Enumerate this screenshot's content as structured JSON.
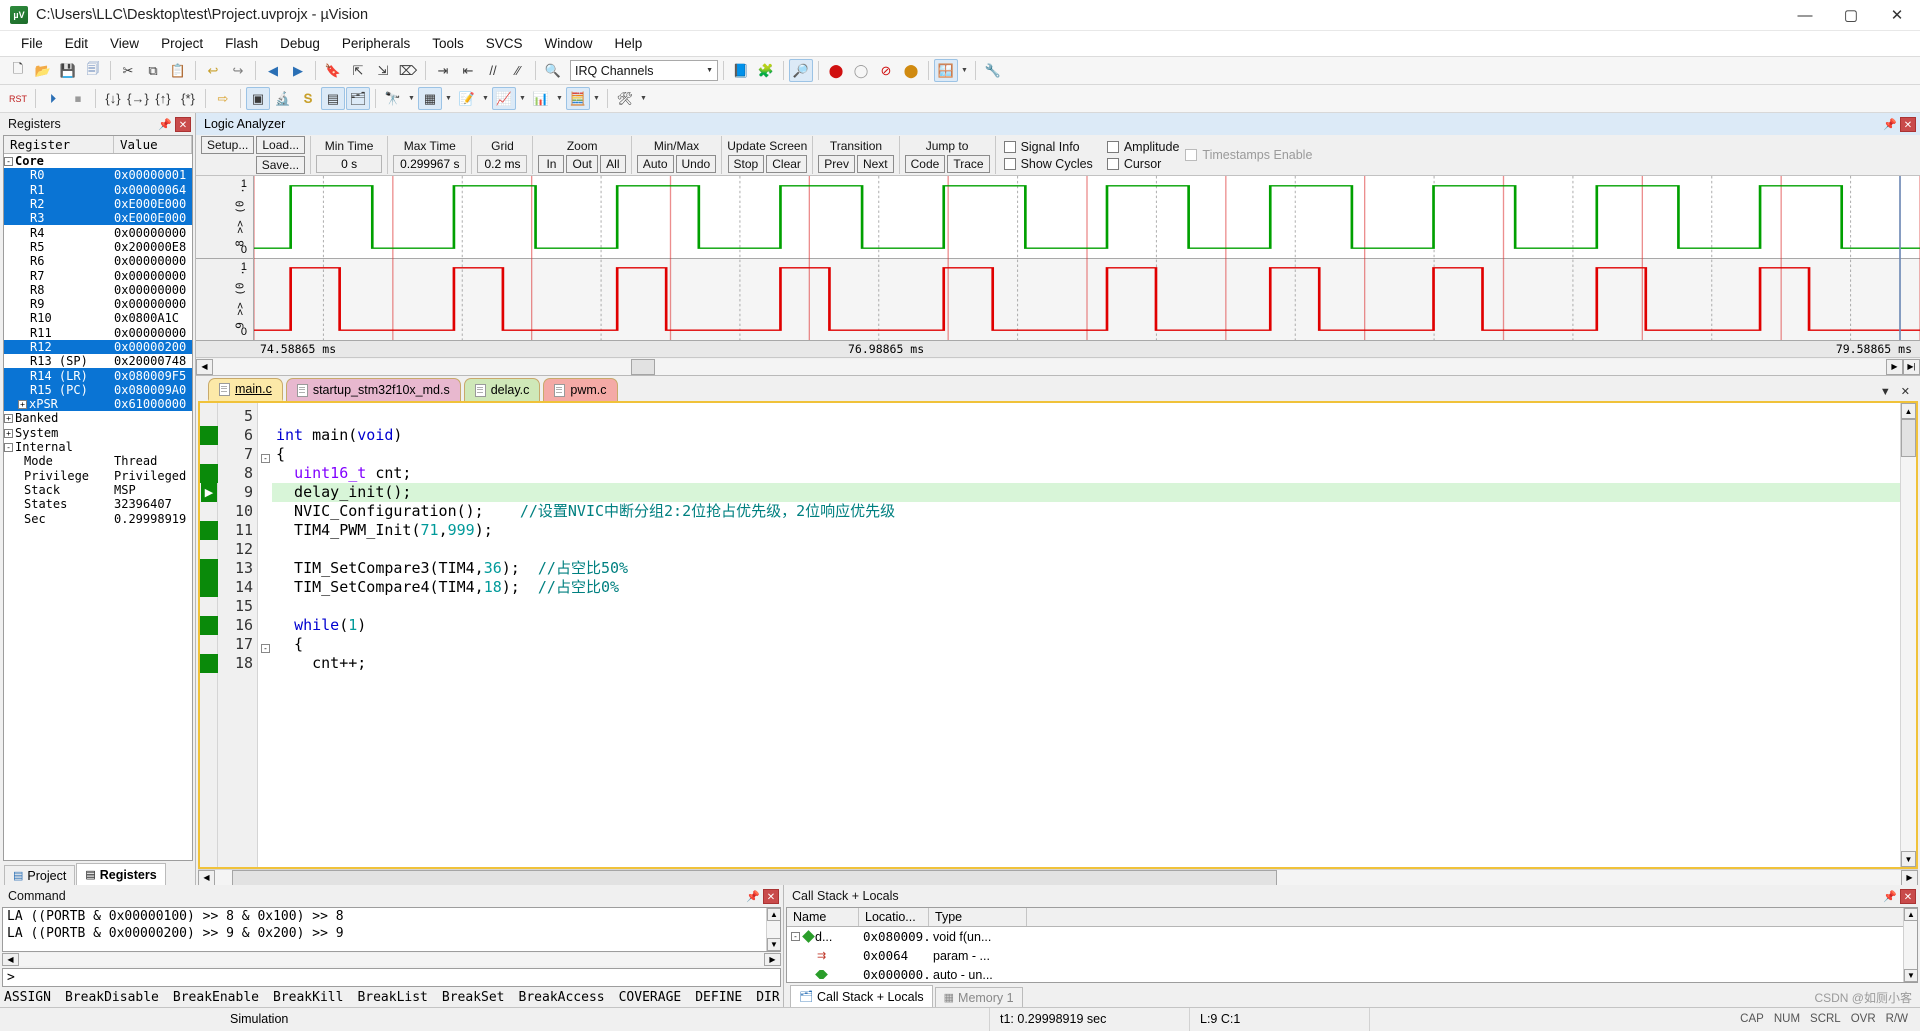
{
  "window": {
    "title": "C:\\Users\\LLC\\Desktop\\test\\Project.uvprojx - µVision",
    "icon": "uvision-logo",
    "minimize": "—",
    "maximize": "▢",
    "close": "✕"
  },
  "menu": [
    "File",
    "Edit",
    "View",
    "Project",
    "Flash",
    "Debug",
    "Peripherals",
    "Tools",
    "SVCS",
    "Window",
    "Help"
  ],
  "toolbar2": {
    "combo_value": "IRQ Channels"
  },
  "registers_pane": {
    "title": "Registers",
    "columns": [
      "Register",
      "Value"
    ],
    "rows": [
      {
        "name": "Core",
        "value": "",
        "level": 0,
        "group": true,
        "toggle": "-",
        "selected": false
      },
      {
        "name": "R0",
        "value": "0x00000001",
        "level": 2,
        "selected": true
      },
      {
        "name": "R1",
        "value": "0x00000064",
        "level": 2,
        "selected": true
      },
      {
        "name": "R2",
        "value": "0xE000E000",
        "level": 2,
        "selected": true
      },
      {
        "name": "R3",
        "value": "0xE000E000",
        "level": 2,
        "selected": true
      },
      {
        "name": "R4",
        "value": "0x00000000",
        "level": 2,
        "selected": false
      },
      {
        "name": "R5",
        "value": "0x200000E8",
        "level": 2,
        "selected": false
      },
      {
        "name": "R6",
        "value": "0x00000000",
        "level": 2,
        "selected": false
      },
      {
        "name": "R7",
        "value": "0x00000000",
        "level": 2,
        "selected": false
      },
      {
        "name": "R8",
        "value": "0x00000000",
        "level": 2,
        "selected": false
      },
      {
        "name": "R9",
        "value": "0x00000000",
        "level": 2,
        "selected": false
      },
      {
        "name": "R10",
        "value": "0x0800A1C",
        "level": 2,
        "selected": false
      },
      {
        "name": "R11",
        "value": "0x00000000",
        "level": 2,
        "selected": false
      },
      {
        "name": "R12",
        "value": "0x00000200",
        "level": 2,
        "selected": true
      },
      {
        "name": "R13 (SP)",
        "value": "0x20000748",
        "level": 2,
        "selected": false
      },
      {
        "name": "R14 (LR)",
        "value": "0x080009F5",
        "level": 2,
        "selected": true
      },
      {
        "name": "R15 (PC)",
        "value": "0x080009A0",
        "level": 2,
        "selected": true
      },
      {
        "name": "xPSR",
        "value": "0x61000000",
        "level": 2,
        "toggle": "+",
        "selected": true
      },
      {
        "name": "Banked",
        "value": "",
        "level": 0,
        "group": false,
        "toggle": "+",
        "selected": false
      },
      {
        "name": "System",
        "value": "",
        "level": 0,
        "group": false,
        "toggle": "+",
        "selected": false
      },
      {
        "name": "Internal",
        "value": "",
        "level": 0,
        "group": false,
        "toggle": "-",
        "selected": false
      },
      {
        "name": "Mode",
        "value": "Thread",
        "level": 1,
        "selected": false
      },
      {
        "name": "Privilege",
        "value": "Privileged",
        "level": 1,
        "selected": false
      },
      {
        "name": "Stack",
        "value": "MSP",
        "level": 1,
        "selected": false
      },
      {
        "name": "States",
        "value": "32396407",
        "level": 1,
        "selected": false
      },
      {
        "name": "Sec",
        "value": "0.29998919",
        "level": 1,
        "selected": false
      }
    ],
    "tabs": [
      {
        "label": "Project",
        "icon": "project-icon",
        "active": false
      },
      {
        "label": "Registers",
        "icon": "registers-icon",
        "active": true
      }
    ]
  },
  "logic_analyzer": {
    "title": "Logic Analyzer",
    "buttons": {
      "setup": "Setup...",
      "load": "Load...",
      "save": "Save..."
    },
    "fields": [
      {
        "label": "Min Time",
        "value": "0 s"
      },
      {
        "label": "Max Time",
        "value": "0.299967 s"
      },
      {
        "label": "Grid",
        "value": "0.2 ms"
      }
    ],
    "groups": [
      {
        "label": "Zoom",
        "buttons": [
          "In",
          "Out",
          "All"
        ]
      },
      {
        "label": "Min/Max",
        "buttons": [
          "Auto",
          "Undo"
        ]
      },
      {
        "label": "Update Screen",
        "buttons": [
          "Stop",
          "Clear"
        ]
      },
      {
        "label": "Transition",
        "buttons": [
          "Prev",
          "Next"
        ]
      },
      {
        "label": "Jump to",
        "buttons": [
          "Code",
          "Trace"
        ]
      }
    ],
    "checkboxes": [
      {
        "label": "Signal Info",
        "checked": false,
        "disabled": false
      },
      {
        "label": "Amplitude",
        "checked": false,
        "disabled": false
      },
      {
        "label": "Timestamps Enable",
        "checked": false,
        "disabled": true
      },
      {
        "label": "Show Cycles",
        "checked": false,
        "disabled": false
      },
      {
        "label": "Cursor",
        "checked": false,
        "disabled": false
      }
    ],
    "signals": [
      {
        "name": "8 >> (0 .",
        "high": "1",
        "low": "0",
        "color": "#00a000"
      },
      {
        "name": "9 >> (0 .",
        "high": "1",
        "low": "0",
        "color": "#e00000"
      }
    ],
    "axis": [
      {
        "text": "74.58865 ms",
        "pos_pct": 0.5
      },
      {
        "text": "76.98865 ms",
        "pos_pct": 49.5
      },
      {
        "text": "79.58865 ms",
        "pos_pct": 92.0
      }
    ]
  },
  "editor": {
    "tabs": [
      {
        "label": "main.c",
        "active": true,
        "color": "#fce9a8"
      },
      {
        "label": "startup_stm32f10x_md.s",
        "active": false,
        "color": "#e8b8cf"
      },
      {
        "label": "delay.c",
        "active": false,
        "color": "#cfe8b8"
      },
      {
        "label": "pwm.c",
        "active": false,
        "color": "#f4aaa6"
      }
    ],
    "lines": [
      {
        "num": "5",
        "text": "",
        "exec": false,
        "hl": false
      },
      {
        "num": "6",
        "text": "int main(void)",
        "exec": true,
        "hl": false
      },
      {
        "num": "7",
        "text": "{",
        "exec": false,
        "hl": false,
        "fold": "-"
      },
      {
        "num": "8",
        "text": "  uint16_t cnt;",
        "exec": true,
        "hl": false
      },
      {
        "num": "9",
        "text": "  delay_init();",
        "exec": true,
        "hl": true,
        "marker": "pc"
      },
      {
        "num": "10",
        "text": "  NVIC_Configuration();    //设置NVIC中断分组2:2位抢占优先级，2位响应优先级",
        "exec": false,
        "hl": false
      },
      {
        "num": "11",
        "text": "  TIM4_PWM_Init(71,999);",
        "exec": true,
        "hl": false
      },
      {
        "num": "12",
        "text": "",
        "exec": false,
        "hl": false
      },
      {
        "num": "13",
        "text": "  TIM_SetCompare3(TIM4,36);  //占空比50%",
        "exec": true,
        "hl": false
      },
      {
        "num": "14",
        "text": "  TIM_SetCompare4(TIM4,18);  //占空比0%",
        "exec": true,
        "hl": false
      },
      {
        "num": "15",
        "text": "",
        "exec": false,
        "hl": false
      },
      {
        "num": "16",
        "text": "  while(1)",
        "exec": true,
        "hl": false
      },
      {
        "num": "17",
        "text": "  {",
        "exec": false,
        "hl": false,
        "fold": "-"
      },
      {
        "num": "18",
        "text": "    cnt++;",
        "exec": true,
        "hl": false
      }
    ]
  },
  "command_pane": {
    "title": "Command",
    "output": [
      "LA ((PORTB & 0x00000100) >> 8 & 0x100) >> 8",
      "LA ((PORTB & 0x00000200) >> 9 & 0x200) >> 9"
    ],
    "prompt": ">",
    "buttons": [
      "ASSIGN",
      "BreakDisable",
      "BreakEnable",
      "BreakKill",
      "BreakList",
      "BreakSet",
      "BreakAccess",
      "COVERAGE",
      "DEFINE",
      "DIR"
    ]
  },
  "call_stack_pane": {
    "title": "Call Stack + Locals",
    "columns": [
      "Name",
      "Locatio...",
      "Type"
    ],
    "rows": [
      {
        "name": "d...",
        "location": "0x080009...",
        "type": "void f(un...",
        "icon": "function-icon",
        "expander": "-"
      },
      {
        "name": "",
        "location": "0x0064",
        "type": "param - ...",
        "icon": "param-icon",
        "expander": ""
      },
      {
        "name": "",
        "location": "0x000000...",
        "type": "auto - un...",
        "icon": "auto-icon",
        "expander": ""
      }
    ],
    "tabs": [
      {
        "label": "Call Stack + Locals",
        "icon": "callstack-icon",
        "active": true
      },
      {
        "label": "Memory 1",
        "icon": "memory-icon",
        "active": false
      }
    ]
  },
  "statusbar": {
    "mode": "Simulation",
    "time": "t1: 0.29998919 sec",
    "position": "L:9 C:1",
    "indicators": [
      "CAP",
      "NUM",
      "SCRL",
      "OVR",
      "R/W"
    ]
  },
  "watermark": "CSDN @如厕小客"
}
